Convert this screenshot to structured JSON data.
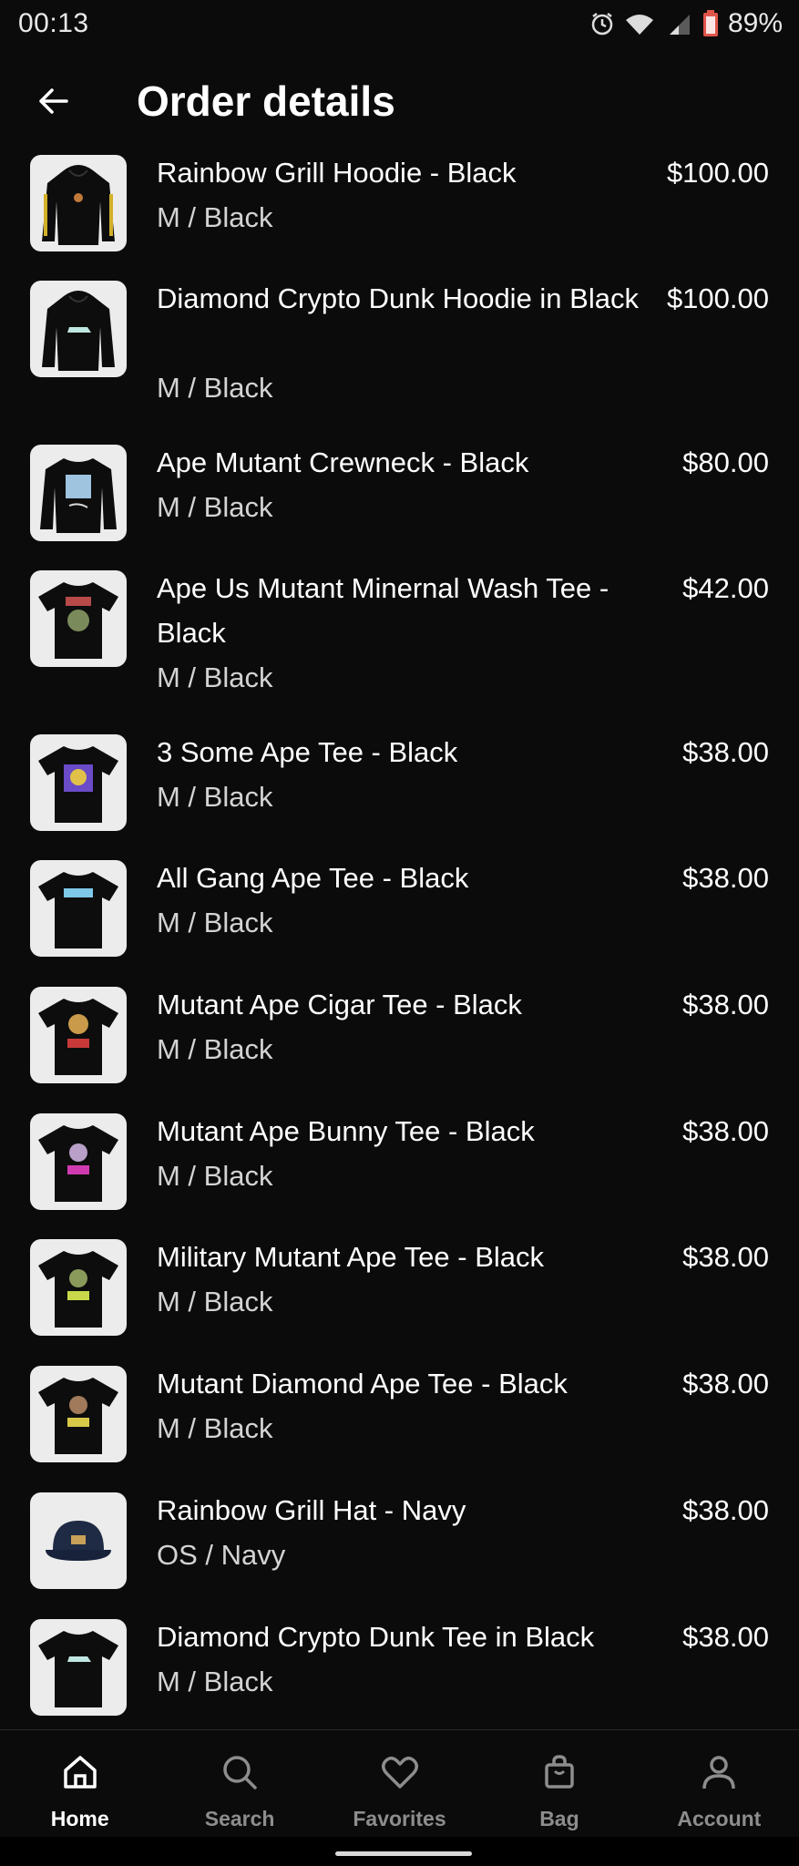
{
  "status_bar": {
    "time": "00:13",
    "battery": "89%"
  },
  "header": {
    "title": "Order details"
  },
  "items": [
    {
      "title": "Rainbow Grill Hoodie - Black",
      "variant": "M / Black",
      "price": "$100.00",
      "thumb": "hoodie"
    },
    {
      "title": "Diamond Crypto Dunk Hoodie in Black",
      "variant": "M / Black",
      "price": "$100.00",
      "thumb": "hoodie"
    },
    {
      "title": "Ape Mutant Crewneck - Black",
      "variant": "M / Black",
      "price": "$80.00",
      "thumb": "crewneck"
    },
    {
      "title": "Ape Us Mutant Minernal Wash Tee - Black",
      "variant": "M / Black",
      "price": "$42.00",
      "thumb": "tee"
    },
    {
      "title": "3 Some Ape Tee - Black",
      "variant": "M / Black",
      "price": "$38.00",
      "thumb": "tee"
    },
    {
      "title": "All Gang Ape Tee - Black",
      "variant": "M / Black",
      "price": "$38.00",
      "thumb": "tee"
    },
    {
      "title": "Mutant Ape Cigar Tee - Black",
      "variant": "M / Black",
      "price": "$38.00",
      "thumb": "tee"
    },
    {
      "title": "Mutant Ape Bunny Tee - Black",
      "variant": "M / Black",
      "price": "$38.00",
      "thumb": "tee"
    },
    {
      "title": "Military Mutant Ape Tee - Black",
      "variant": "M / Black",
      "price": "$38.00",
      "thumb": "tee"
    },
    {
      "title": "Mutant Diamond Ape Tee - Black",
      "variant": "M / Black",
      "price": "$38.00",
      "thumb": "tee"
    },
    {
      "title": "Rainbow Grill Hat - Navy",
      "variant": "OS / Navy",
      "price": "$38.00",
      "thumb": "hat"
    },
    {
      "title": "Diamond Crypto Dunk Tee in Black",
      "variant": "M / Black",
      "price": "$38.00",
      "thumb": "tee"
    }
  ],
  "bottom_nav": [
    {
      "label": "Home",
      "icon": "home-icon",
      "active": true
    },
    {
      "label": "Search",
      "icon": "search-icon",
      "active": false
    },
    {
      "label": "Favorites",
      "icon": "heart-icon",
      "active": false
    },
    {
      "label": "Bag",
      "icon": "bag-icon",
      "active": false
    },
    {
      "label": "Account",
      "icon": "account-icon",
      "active": false
    }
  ],
  "colors": {
    "background": "#0b0b0c",
    "active_nav": "#ffffff",
    "inactive_nav": "#8d8d8d",
    "thumb_bg": "#ececec"
  }
}
